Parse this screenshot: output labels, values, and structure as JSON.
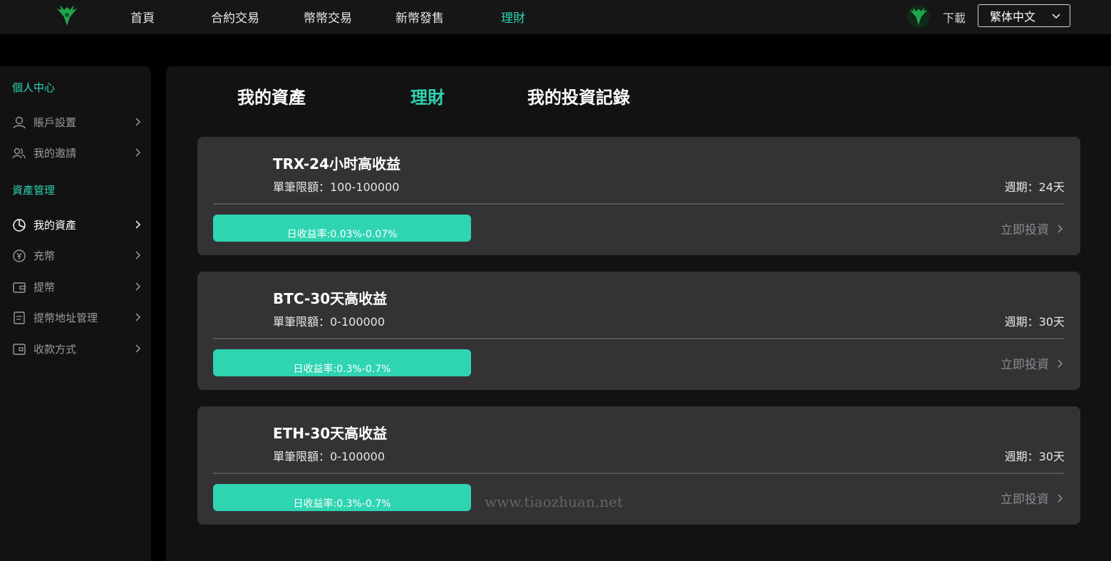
{
  "nav": {
    "items": [
      {
        "label": "首頁",
        "active": false
      },
      {
        "label": "合約交易",
        "active": false
      },
      {
        "label": "幣幣交易",
        "active": false
      },
      {
        "label": "新幣發售",
        "active": false
      },
      {
        "label": "理財",
        "active": true
      }
    ],
    "download_label": "下載",
    "language": "繁体中文"
  },
  "sidebar": {
    "section1": "個人中心",
    "section1_items": [
      {
        "label": "賬戶設置",
        "icon": "user-icon"
      },
      {
        "label": "我的邀請",
        "icon": "users-icon"
      }
    ],
    "section2": "資產管理",
    "section2_items": [
      {
        "label": "我的資產",
        "icon": "pie-chart-icon",
        "active": true
      },
      {
        "label": "充幣",
        "icon": "yen-coin-icon"
      },
      {
        "label": "提幣",
        "icon": "wallet-icon"
      },
      {
        "label": "提幣地址管理",
        "icon": "document-icon"
      },
      {
        "label": "收款方式",
        "icon": "card-icon"
      }
    ]
  },
  "tabs": [
    {
      "label": "我的資產",
      "active": false
    },
    {
      "label": "理財",
      "active": true
    },
    {
      "label": "我的投資記錄",
      "active": false
    }
  ],
  "products": [
    {
      "name": "TRX-24小时高收益",
      "limit": "單筆限額：100-100000",
      "period": "週期：24天",
      "rate": "日收益率:0.03%-0.07%",
      "action": "立即投資"
    },
    {
      "name": "BTC-30天高收益",
      "limit": "單筆限額：0-100000",
      "period": "週期：30天",
      "rate": "日收益率:0.3%-0.7%",
      "action": "立即投資"
    },
    {
      "name": "ETH-30天高收益",
      "limit": "單筆限額：0-100000",
      "period": "週期：30天",
      "rate": "日收益率:0.3%-0.7%",
      "action": "立即投資"
    }
  ],
  "watermark": "www.tiaozhuan.net",
  "colors": {
    "accent": "#2fd4b1",
    "card": "#333335",
    "background": "#000000"
  }
}
